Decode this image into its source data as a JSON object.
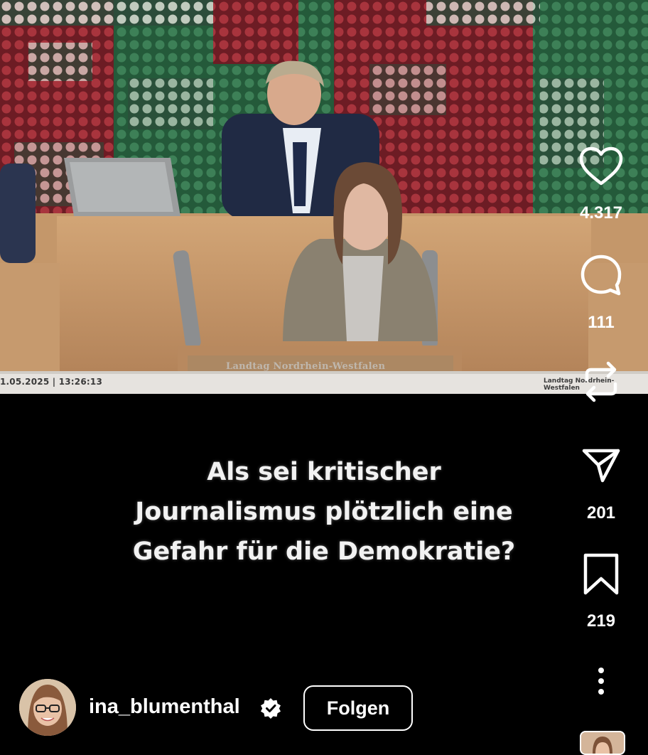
{
  "video": {
    "timestamp": "1.05.2025 | 13:26:13",
    "podium_label": "Landtag Nordrhein-Westfalen",
    "corner_label": "Landtag Nordrhein-Westfalen"
  },
  "caption": {
    "line1": "Als sei kritischer",
    "line2": "Journalismus plötzlich eine",
    "line3": "Gefahr für die Demokratie?"
  },
  "actions": {
    "like": {
      "icon": "heart-icon",
      "count": "4.317"
    },
    "comment": {
      "icon": "comment-icon",
      "count": "111"
    },
    "repost": {
      "icon": "repost-icon"
    },
    "share": {
      "icon": "send-icon",
      "count": "201"
    },
    "save": {
      "icon": "bookmark-icon",
      "count": "219"
    },
    "more": {
      "icon": "more-vertical-icon"
    }
  },
  "author": {
    "username": "ina_blumenthal",
    "verified": true,
    "follow_label": "Folgen"
  },
  "colors": {
    "background": "#000000",
    "text": "#ffffff",
    "wall_green": "#2f6b47",
    "wall_red": "#8e2a32",
    "podium_wood": "#c89b6c"
  }
}
